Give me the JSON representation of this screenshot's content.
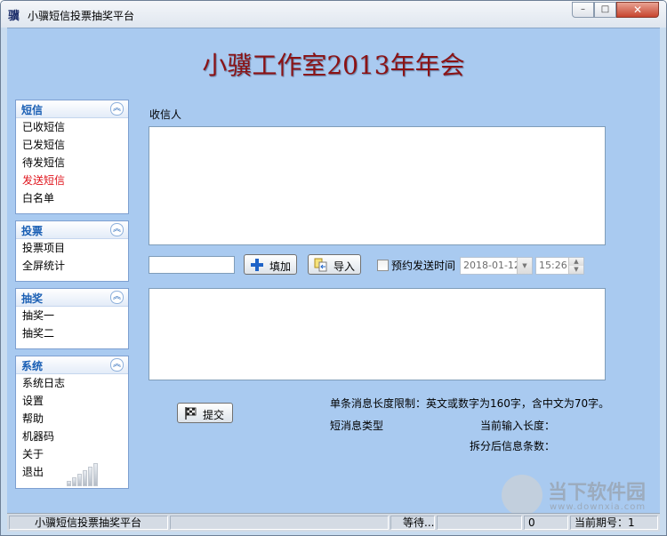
{
  "window": {
    "title": "小骥短信投票抽奖平台",
    "app_icon_text": "骥",
    "controls": {
      "minimize": "–",
      "maximize": "□",
      "close": "✕"
    }
  },
  "banner": {
    "title": "小骥工作室2013年年会"
  },
  "sidebar": {
    "panels": [
      {
        "title": "短信",
        "items": [
          "已收短信",
          "已发短信",
          "待发短信",
          "发送短信",
          "白名单"
        ],
        "active": "发送短信"
      },
      {
        "title": "投票",
        "items": [
          "投票项目",
          "全屏统计"
        ]
      },
      {
        "title": "抽奖",
        "items": [
          "抽奖一",
          "抽奖二"
        ]
      },
      {
        "title": "系统",
        "items": [
          "系统日志",
          "设置",
          "帮助",
          "机器码",
          "关于",
          "退出"
        ]
      }
    ],
    "collapse_icon": "chevron-up-double-icon"
  },
  "form": {
    "recipient_label": "收信人",
    "recipient_value": "",
    "phone_input_value": "",
    "add_button": "填加",
    "import_button": "导入",
    "schedule_label": "预约发送时间",
    "schedule_checked": false,
    "date_value": "2018-01-12",
    "time_value": "15:26",
    "message_value": "",
    "submit_button": "提交"
  },
  "info": {
    "length_limit": "单条消息长度限制：英文或数字为160字，含中文为70字。",
    "msg_type_label": "短消息类型",
    "current_length_label": "当前输入长度：",
    "split_count_label": "拆分后信息条数："
  },
  "statusbar": {
    "app_name": "小骥短信投票抽奖平台",
    "status": "等待...",
    "count": "0",
    "period_label": "当前期号：",
    "period_value": "1"
  },
  "watermark": {
    "brand": "当下软件园",
    "url": "www.downxia.com"
  },
  "colors": {
    "client_bg": "#a9caf0",
    "banner": "#8b1214",
    "panel_title": "#1a5fb4",
    "active_item": "#e0141c"
  }
}
